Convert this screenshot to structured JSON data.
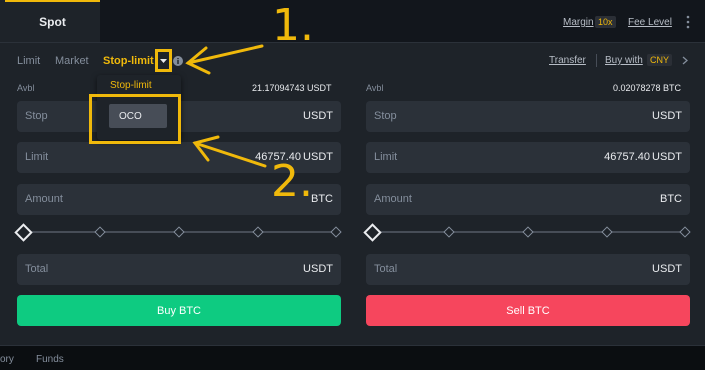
{
  "tabs": {
    "spot": "Spot"
  },
  "header": {
    "margin_label": "Margin",
    "margin_badge": "10x",
    "fee_level": "Fee Level",
    "more_icon": "vertical-dots-icon"
  },
  "order_types": [
    "Limit",
    "Market",
    "Stop-limit"
  ],
  "right_links": {
    "transfer": "Transfer",
    "buy_with": "Buy with",
    "currency": "CNY"
  },
  "buy": {
    "avbl_label": "Avbl",
    "avbl_value": "21.17094743 USDT",
    "stop_label": "Stop",
    "stop_unit": "USDT",
    "limit_label": "Limit",
    "limit_value": "46757.40",
    "limit_unit": "USDT",
    "amount_label": "Amount",
    "amount_unit": "BTC",
    "total_label": "Total",
    "total_unit": "USDT",
    "button": "Buy BTC"
  },
  "sell": {
    "avbl_label": "Avbl",
    "avbl_value": "0.02078278 BTC",
    "stop_label": "Stop",
    "stop_unit": "USDT",
    "limit_label": "Limit",
    "limit_value": "46757.40",
    "limit_unit": "USDT",
    "amount_label": "Amount",
    "amount_unit": "BTC",
    "total_label": "Total",
    "total_unit": "USDT",
    "button": "Sell BTC"
  },
  "dropdown": {
    "title": "Stop-limit",
    "option": "OCO"
  },
  "annotations": {
    "one": "1.",
    "two": "2."
  },
  "bottom_tabs": [
    "ory",
    "Funds"
  ],
  "colors": {
    "accent": "#f0b90b",
    "buy": "#0ecb81",
    "sell": "#f6465d"
  }
}
